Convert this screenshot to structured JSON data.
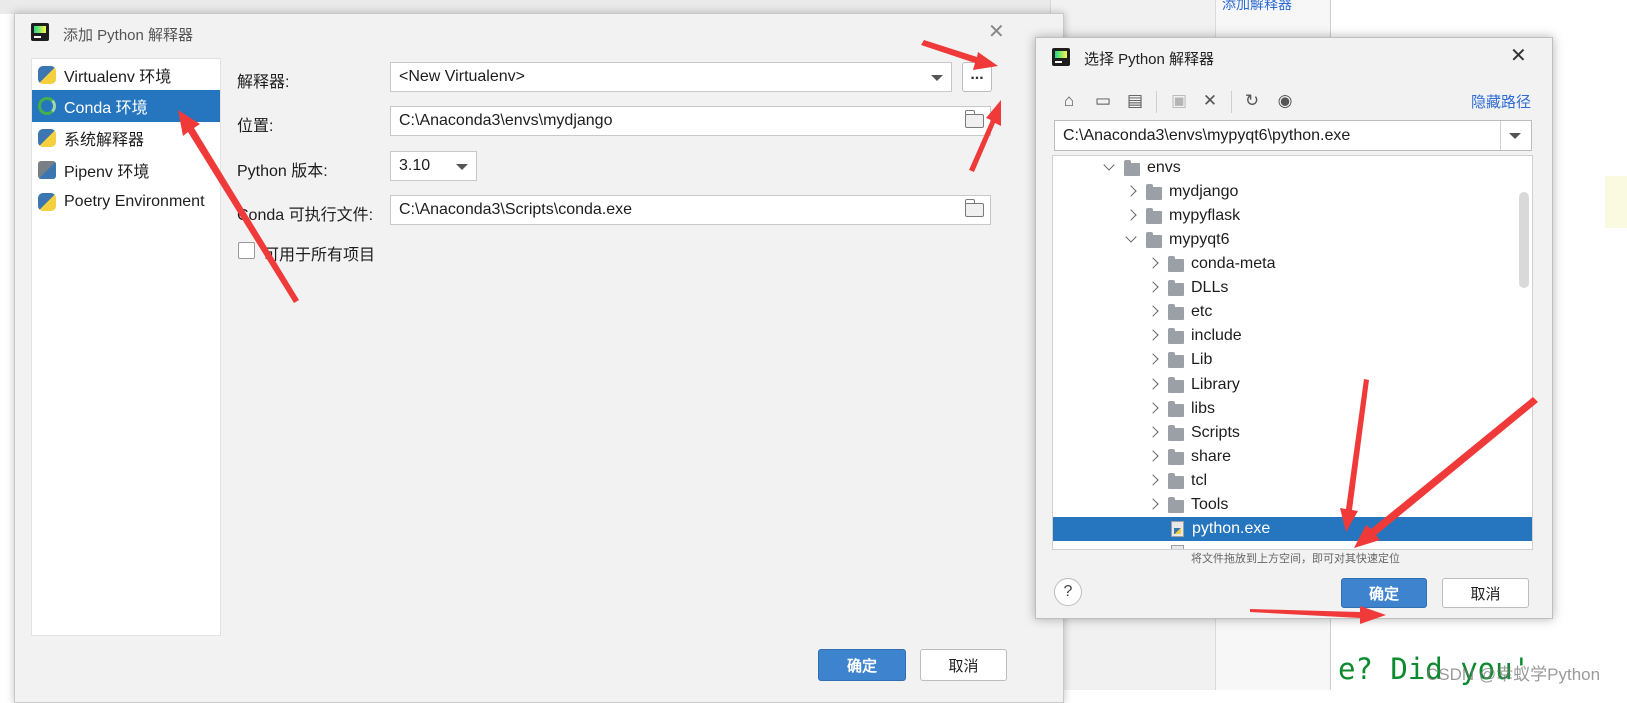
{
  "background": {
    "link_text": "添加解释器",
    "code_text": "e? Did you'",
    "watermark": "CSDN @幸蚁学Python"
  },
  "main_dialog": {
    "title": "添加 Python 解释器",
    "sidebar": [
      {
        "label": "Virtualenv 环境",
        "icon": "python-icon"
      },
      {
        "label": "Conda 环境",
        "icon": "conda-icon",
        "selected": true
      },
      {
        "label": "系统解释器",
        "icon": "python-icon"
      },
      {
        "label": "Pipenv 环境",
        "icon": "pipenv-icon"
      },
      {
        "label": "Poetry Environment",
        "icon": "python-icon"
      }
    ],
    "form": {
      "interpreter_label": "解释器:",
      "interpreter_value": "<New Virtualenv>",
      "browse_label": "...",
      "location_label": "位置:",
      "location_value": "C:\\Anaconda3\\envs\\mydjango",
      "python_version_label": "Python 版本:",
      "python_version_value": "3.10",
      "conda_exe_label": "Conda 可执行文件:",
      "conda_exe_value": "C:\\Anaconda3\\Scripts\\conda.exe",
      "all_projects_label": "可用于所有项目"
    },
    "ok_label": "确定",
    "cancel_label": "取消"
  },
  "chooser_dialog": {
    "title": "选择 Python 解释器",
    "hide_path_label": "隐藏路径",
    "path_value": "C:\\Anaconda3\\envs\\mypyqt6\\python.exe",
    "toolbar_icons": [
      "home-icon",
      "desktop-icon",
      "project-folder-icon",
      "new-folder-icon",
      "delete-icon",
      "refresh-icon",
      "show-hidden-icon"
    ],
    "tree": [
      {
        "label": "envs",
        "level": 0,
        "expanded": true,
        "type": "folder"
      },
      {
        "label": "mydjango",
        "level": 1,
        "expanded": false,
        "type": "folder"
      },
      {
        "label": "mypyflask",
        "level": 1,
        "expanded": false,
        "type": "folder"
      },
      {
        "label": "mypyqt6",
        "level": 1,
        "expanded": true,
        "type": "folder"
      },
      {
        "label": "conda-meta",
        "level": 2,
        "expanded": false,
        "type": "folder"
      },
      {
        "label": "DLLs",
        "level": 2,
        "expanded": false,
        "type": "folder"
      },
      {
        "label": "etc",
        "level": 2,
        "expanded": false,
        "type": "folder"
      },
      {
        "label": "include",
        "level": 2,
        "expanded": false,
        "type": "folder"
      },
      {
        "label": "Lib",
        "level": 2,
        "expanded": false,
        "type": "folder"
      },
      {
        "label": "Library",
        "level": 2,
        "expanded": false,
        "type": "folder"
      },
      {
        "label": "libs",
        "level": 2,
        "expanded": false,
        "type": "folder"
      },
      {
        "label": "Scripts",
        "level": 2,
        "expanded": false,
        "type": "folder"
      },
      {
        "label": "share",
        "level": 2,
        "expanded": false,
        "type": "folder"
      },
      {
        "label": "tcl",
        "level": 2,
        "expanded": false,
        "type": "folder"
      },
      {
        "label": "Tools",
        "level": 2,
        "expanded": false,
        "type": "folder"
      },
      {
        "label": "python.exe",
        "level": 2,
        "type": "file",
        "selected": true
      }
    ],
    "hint": "将文件拖放到上方空间，即可对其快速定位",
    "help_label": "?",
    "ok_label": "确定",
    "cancel_label": "取消"
  },
  "colors": {
    "selection": "#2675bf",
    "primary_button": "#3d83cd",
    "annotation_arrow": "#f03a3a",
    "link": "#2f6dd4"
  }
}
